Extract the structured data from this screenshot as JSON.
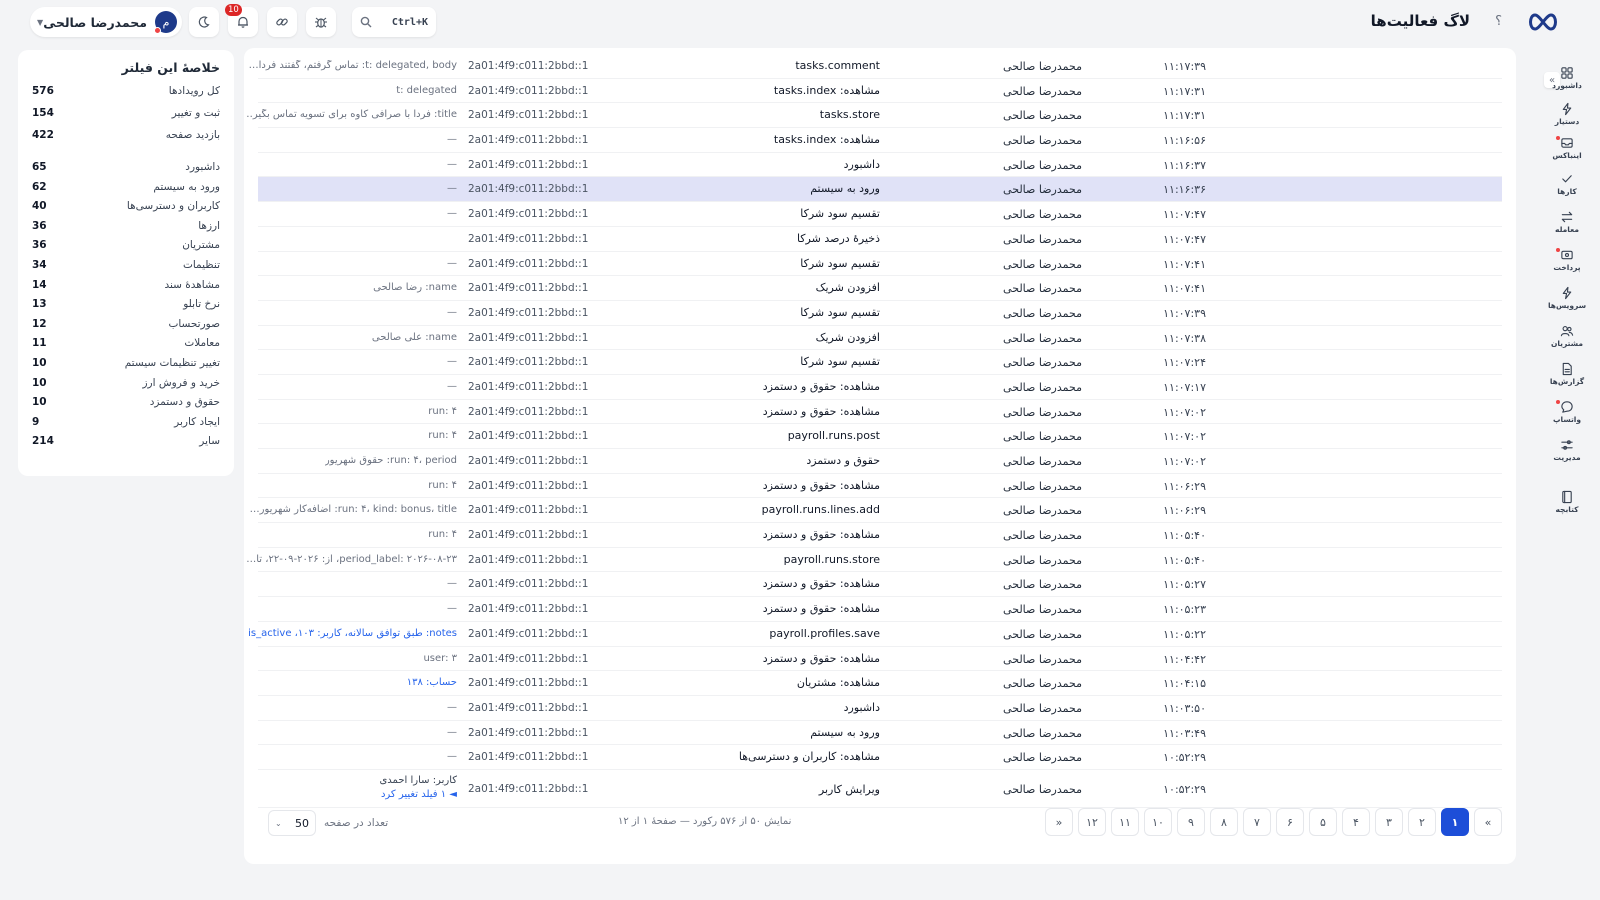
{
  "header": {
    "title": "لاگ فعالیت‌ها",
    "help": "؟",
    "search_shortcut": "Ctrl+K",
    "notifications_count": "10",
    "user_name": "محمدرضا صالحی",
    "avatar_initial": "م"
  },
  "colors": {
    "accent": "#1d4ed8",
    "highlight_row": "#e0e2f7",
    "badge": "#dc2626",
    "link": "#2563eb"
  },
  "sidebar": {
    "collapse_icon": "«",
    "items": [
      {
        "label": "داشبورد",
        "icon": "grid-icon",
        "dot": false
      },
      {
        "label": "دستیار",
        "icon": "bolt-icon",
        "dot": false
      },
      {
        "label": "اینباکس",
        "icon": "inbox-icon",
        "dot": true
      },
      {
        "label": "کارها",
        "icon": "check-icon",
        "dot": false
      },
      {
        "label": "معامله",
        "icon": "swap-icon",
        "dot": false
      },
      {
        "label": "پرداخت",
        "icon": "wallet-icon",
        "dot": true
      },
      {
        "label": "سرویس‌ها",
        "icon": "lightning-icon",
        "dot": false
      },
      {
        "label": "مشتریان",
        "icon": "users-icon",
        "dot": false
      },
      {
        "label": "گزارش‌ها",
        "icon": "report-icon",
        "dot": false
      },
      {
        "label": "واتساپ",
        "icon": "chat-icon",
        "dot": true
      },
      {
        "label": "مدیریت",
        "icon": "sliders-icon",
        "dot": false
      },
      {
        "label": "کتابچه",
        "icon": "book-icon",
        "dot": false
      }
    ]
  },
  "summary": {
    "title": "خلاصهٔ این فیلتر",
    "totals": [
      {
        "label": "کل رویدادها",
        "value": "576"
      },
      {
        "label": "ثبت و تغییر",
        "value": "154"
      },
      {
        "label": "بازدید صفحه",
        "value": "422"
      }
    ],
    "categories": [
      {
        "label": "داشبورد",
        "value": "65"
      },
      {
        "label": "ورود به سیستم",
        "value": "62"
      },
      {
        "label": "کاربران و دسترسی‌ها",
        "value": "40"
      },
      {
        "label": "ارزها",
        "value": "36"
      },
      {
        "label": "مشتریان",
        "value": "36"
      },
      {
        "label": "تنظیمات",
        "value": "34"
      },
      {
        "label": "مشاهدهٔ سند",
        "value": "14"
      },
      {
        "label": "نرخ تابلو",
        "value": "13"
      },
      {
        "label": "صورتحساب",
        "value": "12"
      },
      {
        "label": "معاملات",
        "value": "11"
      },
      {
        "label": "تغییر تنظیمات سیستم",
        "value": "10"
      },
      {
        "label": "خرید و فروش ارز",
        "value": "10"
      },
      {
        "label": "حقوق و دستمزد",
        "value": "10"
      },
      {
        "label": "ایجاد کاربر",
        "value": "9"
      },
      {
        "label": "سایر",
        "value": "214"
      }
    ]
  },
  "table": {
    "rows": [
      {
        "time": "۱۱:۱۷:۳۹",
        "user": "محمدرضا صالحی",
        "action": "tasks.comment",
        "ip": "2a01:4f9:c011:2bbd::1",
        "details": "t: delegated, body: تماس گرفتم، گفتند فردا…",
        "blue": false
      },
      {
        "time": "۱۱:۱۷:۳۱",
        "user": "محمدرضا صالحی",
        "action": "مشاهده: tasks.index",
        "ip": "2a01:4f9:c011:2bbd::1",
        "details": "t: delegated",
        "blue": false
      },
      {
        "time": "۱۱:۱۷:۳۱",
        "user": "محمدرضا صالحی",
        "action": "tasks.store",
        "ip": "2a01:4f9:c011:2bbd::1",
        "details": "title: فردا با صرافی کاوه برای تسویه تماس بگیر…",
        "blue": false
      },
      {
        "time": "۱۱:۱۶:۵۶",
        "user": "محمدرضا صالحی",
        "action": "مشاهده: tasks.index",
        "ip": "2a01:4f9:c011:2bbd::1",
        "details": "—",
        "blue": false
      },
      {
        "time": "۱۱:۱۶:۳۷",
        "user": "محمدرضا صالحی",
        "action": "داشبورد",
        "ip": "2a01:4f9:c011:2bbd::1",
        "details": "—",
        "blue": false
      },
      {
        "time": "۱۱:۱۶:۳۶",
        "user": "محمدرضا صالحی",
        "action": "ورود به سیستم",
        "ip": "2a01:4f9:c011:2bbd::1",
        "details": "—",
        "blue": false,
        "highlight": true
      },
      {
        "time": "۱۱:۰۷:۴۷",
        "user": "محمدرضا صالحی",
        "action": "تقسیم سود شرکا",
        "ip": "2a01:4f9:c011:2bbd::1",
        "details": "—",
        "blue": false
      },
      {
        "time": "۱۱:۰۷:۴۷",
        "user": "محمدرضا صالحی",
        "action": "ذخیرهٔ درصد شرکا",
        "ip": "2a01:4f9:c011:2bbd::1",
        "details": "",
        "blue": false
      },
      {
        "time": "۱۱:۰۷:۴۱",
        "user": "محمدرضا صالحی",
        "action": "تقسیم سود شرکا",
        "ip": "2a01:4f9:c011:2bbd::1",
        "details": "—",
        "blue": false
      },
      {
        "time": "۱۱:۰۷:۴۱",
        "user": "محمدرضا صالحی",
        "action": "افزودن شریک",
        "ip": "2a01:4f9:c011:2bbd::1",
        "details": "name: رضا صالحی",
        "blue": false
      },
      {
        "time": "۱۱:۰۷:۳۹",
        "user": "محمدرضا صالحی",
        "action": "تقسیم سود شرکا",
        "ip": "2a01:4f9:c011:2bbd::1",
        "details": "—",
        "blue": false
      },
      {
        "time": "۱۱:۰۷:۳۸",
        "user": "محمدرضا صالحی",
        "action": "افزودن شریک",
        "ip": "2a01:4f9:c011:2bbd::1",
        "details": "name: علی صالحی",
        "blue": false
      },
      {
        "time": "۱۱:۰۷:۲۴",
        "user": "محمدرضا صالحی",
        "action": "تقسیم سود شرکا",
        "ip": "2a01:4f9:c011:2bbd::1",
        "details": "—",
        "blue": false
      },
      {
        "time": "۱۱:۰۷:۱۷",
        "user": "محمدرضا صالحی",
        "action": "مشاهده: حقوق و دستمزد",
        "ip": "2a01:4f9:c011:2bbd::1",
        "details": "—",
        "blue": false
      },
      {
        "time": "۱۱:۰۷:۰۲",
        "user": "محمدرضا صالحی",
        "action": "مشاهده: حقوق و دستمزد",
        "ip": "2a01:4f9:c011:2bbd::1",
        "details": "run: ۴",
        "blue": false
      },
      {
        "time": "۱۱:۰۷:۰۲",
        "user": "محمدرضا صالحی",
        "action": "payroll.runs.post",
        "ip": "2a01:4f9:c011:2bbd::1",
        "details": "run: ۴",
        "blue": false
      },
      {
        "time": "۱۱:۰۷:۰۲",
        "user": "محمدرضا صالحی",
        "action": "حقوق و دستمزد",
        "ip": "2a01:4f9:c011:2bbd::1",
        "details": "run: ۴، period: حقوق شهریور",
        "blue": false
      },
      {
        "time": "۱۱:۰۶:۲۹",
        "user": "محمدرضا صالحی",
        "action": "مشاهده: حقوق و دستمزد",
        "ip": "2a01:4f9:c011:2bbd::1",
        "details": "run: ۴",
        "blue": false
      },
      {
        "time": "۱۱:۰۶:۲۹",
        "user": "محمدرضا صالحی",
        "action": "payroll.runs.lines.add",
        "ip": "2a01:4f9:c011:2bbd::1",
        "details": "run: ۴، kind: bonus، title: اضافه‌کار شهریور…",
        "blue": false
      },
      {
        "time": "۱۱:۰۵:۴۰",
        "user": "محمدرضا صالحی",
        "action": "مشاهده: حقوق و دستمزد",
        "ip": "2a01:4f9:c011:2bbd::1",
        "details": "run: ۴",
        "blue": false
      },
      {
        "time": "۱۱:۰۵:۴۰",
        "user": "محمدرضا صالحی",
        "action": "payroll.runs.store",
        "ip": "2a01:4f9:c011:2bbd::1",
        "details": "period_label: ۲۰۲۶-۰۸-۲۳، از: ۲۰۲۶-۰۹-۲۲، تا…",
        "blue": false
      },
      {
        "time": "۱۱:۰۵:۲۷",
        "user": "محمدرضا صالحی",
        "action": "مشاهده: حقوق و دستمزد",
        "ip": "2a01:4f9:c011:2bbd::1",
        "details": "—",
        "blue": false
      },
      {
        "time": "۱۱:۰۵:۲۳",
        "user": "محمدرضا صالحی",
        "action": "مشاهده: حقوق و دستمزد",
        "ip": "2a01:4f9:c011:2bbd::1",
        "details": "—",
        "blue": false
      },
      {
        "time": "۱۱:۰۵:۲۲",
        "user": "محمدرضا صالحی",
        "action": "payroll.profiles.save",
        "ip": "2a01:4f9:c011:2bbd::1",
        "details": "notes: طبق توافق سالانه، کاربر: ۱۰۳، is_active…",
        "blue": true
      },
      {
        "time": "۱۱:۰۴:۴۲",
        "user": "محمدرضا صالحی",
        "action": "مشاهده: حقوق و دستمزد",
        "ip": "2a01:4f9:c011:2bbd::1",
        "details": "user: ۳",
        "blue": false
      },
      {
        "time": "۱۱:۰۴:۱۵",
        "user": "محمدرضا صالحی",
        "action": "مشاهده: مشتریان",
        "ip": "2a01:4f9:c011:2bbd::1",
        "details": "حساب: ۱۳۸",
        "blue": true
      },
      {
        "time": "۱۱:۰۳:۵۰",
        "user": "محمدرضا صالحی",
        "action": "داشبورد",
        "ip": "2a01:4f9:c011:2bbd::1",
        "details": "—",
        "blue": false
      },
      {
        "time": "۱۱:۰۳:۴۹",
        "user": "محمدرضا صالحی",
        "action": "ورود به سیستم",
        "ip": "2a01:4f9:c011:2bbd::1",
        "details": "—",
        "blue": false
      },
      {
        "time": "۱۰:۵۲:۲۹",
        "user": "محمدرضا صالحی",
        "action": "مشاهده: کاربران و دسترسی‌ها",
        "ip": "2a01:4f9:c011:2bbd::1",
        "details": "—",
        "blue": false
      }
    ],
    "last_row": {
      "time": "۱۰:۵۲:۲۹",
      "user": "محمدرضا صالحی",
      "action": "ویرایش کاربر",
      "ip": "2a01:4f9:c011:2bbd::1",
      "detail_line1": "کاربر: سارا احمدی",
      "detail_line2": "◄ ۱ فیلد تغییر کرد"
    }
  },
  "footer": {
    "per_page_label": "تعداد در صفحه",
    "per_page_value": "50",
    "range_text": "نمایش ۵۰ از ۵۷۶ رکورد — صفحهٔ ۱ از ۱۲",
    "pages": [
      "«",
      "۱",
      "۲",
      "۳",
      "۴",
      "۵",
      "۶",
      "۷",
      "۸",
      "۹",
      "۱۰",
      "۱۱",
      "۱۲",
      "»"
    ],
    "active_page": 1
  }
}
